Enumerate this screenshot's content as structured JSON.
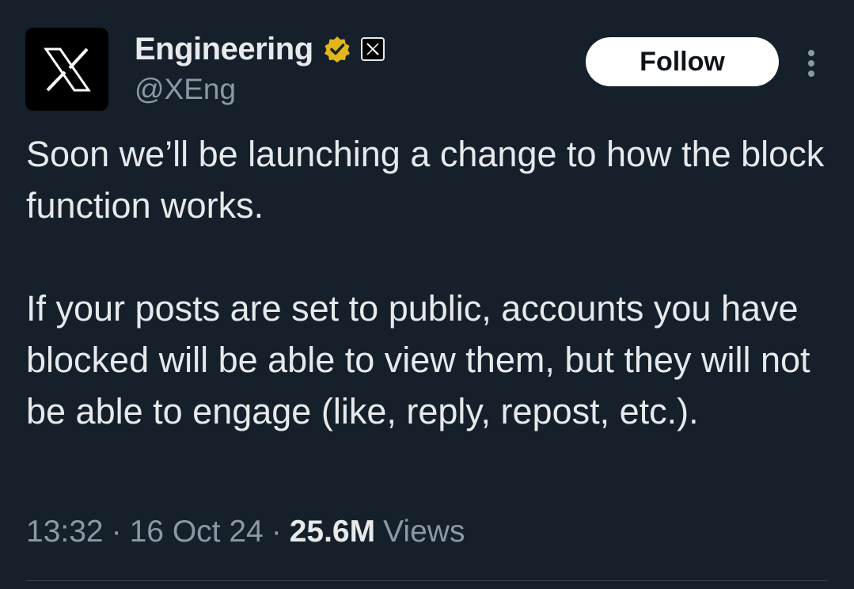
{
  "author": {
    "display_name": "Engineering",
    "handle": "@XEng",
    "avatar_icon": "x-logo-icon",
    "verified_badge": "gold-verified-badge-icon",
    "affiliate_badge": "x-affiliate-badge-icon"
  },
  "actions": {
    "follow_label": "Follow",
    "more_icon": "more-vertical-icon"
  },
  "tweet": {
    "paragraphs": [
      "Soon we’ll be launching a change to how the block function works.",
      "If your posts are set to public, accounts you have blocked will be able to view them, but they will not be able to engage (like, reply, repost, etc.)."
    ]
  },
  "meta": {
    "time": "13:32",
    "separator": "·",
    "date": "16 Oct 24",
    "views_count": "25.6M",
    "views_label": "Views"
  },
  "colors": {
    "background": "#15202b",
    "text_primary": "#e7e9ea",
    "text_secondary": "#8b98a5",
    "verified_gold": "#e2b719",
    "follow_button_bg": "#ffffff"
  }
}
